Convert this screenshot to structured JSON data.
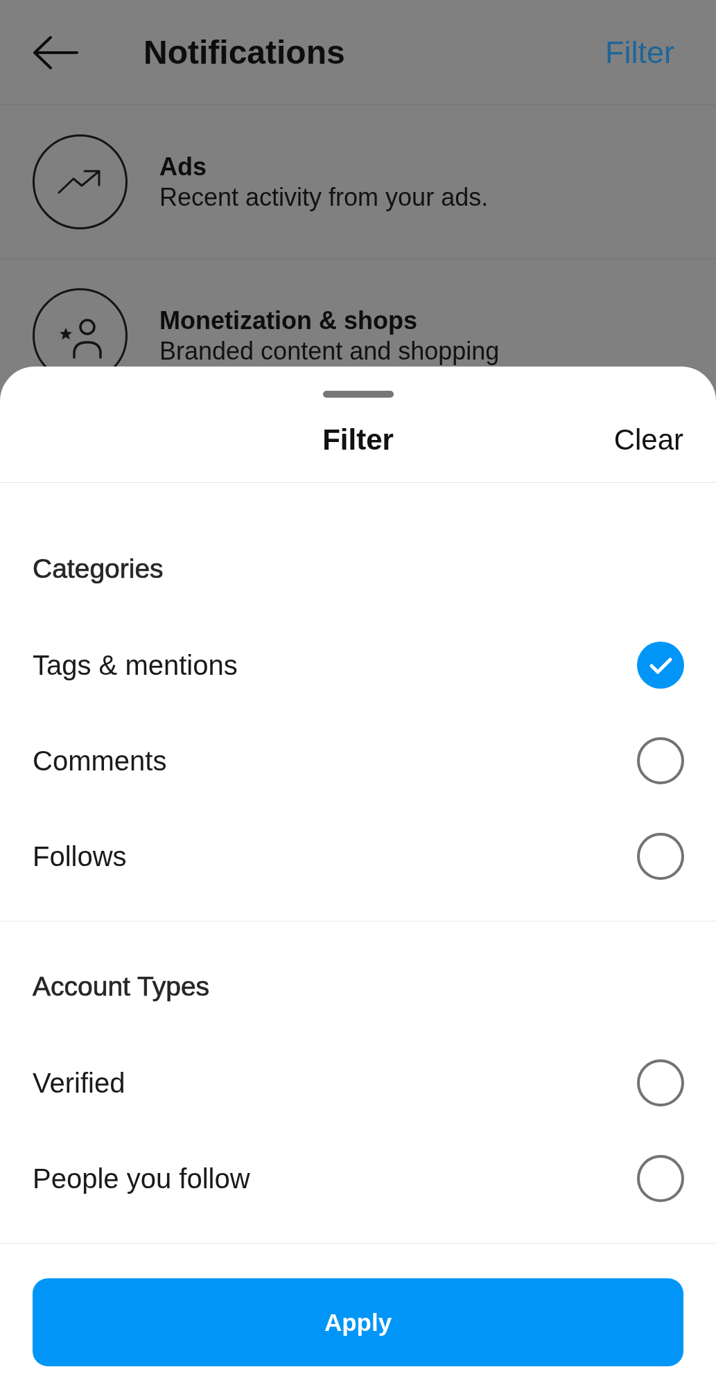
{
  "header": {
    "title": "Notifications",
    "action": "Filter"
  },
  "categories": [
    {
      "kind": "ads",
      "title": "Ads",
      "description": "Recent activity from your ads."
    },
    {
      "kind": "monetization",
      "title": "Monetization & shops",
      "description": "Branded content and shopping"
    }
  ],
  "sheet": {
    "title": "Filter",
    "clear": "Clear",
    "sections": [
      {
        "heading": "Categories",
        "options": [
          {
            "label": "Tags & mentions",
            "checked": true
          },
          {
            "label": "Comments",
            "checked": false
          },
          {
            "label": "Follows",
            "checked": false
          }
        ]
      },
      {
        "heading": "Account Types",
        "options": [
          {
            "label": "Verified",
            "checked": false
          },
          {
            "label": "People you follow",
            "checked": false
          }
        ]
      }
    ],
    "apply": "Apply"
  }
}
